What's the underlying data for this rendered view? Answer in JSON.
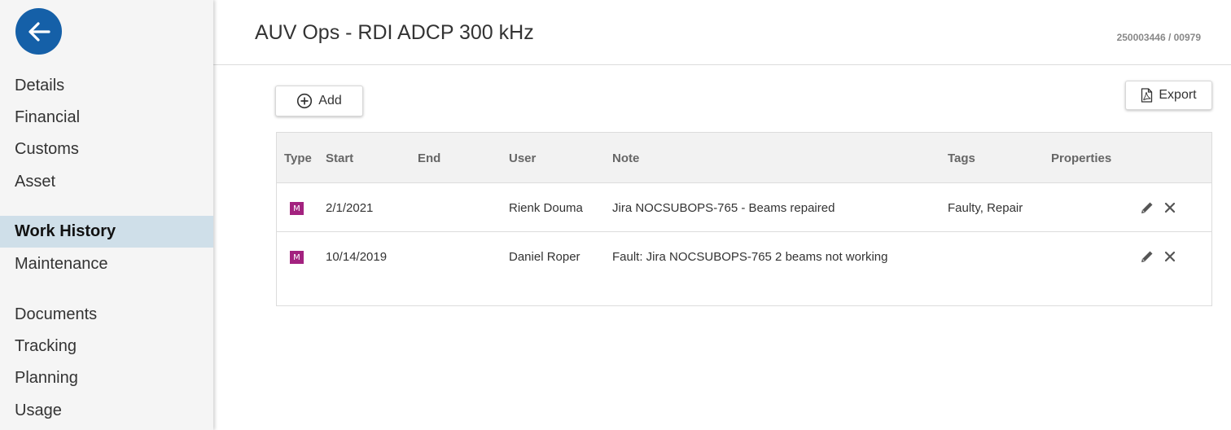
{
  "sidebar": {
    "items": [
      {
        "label": "Details"
      },
      {
        "label": "Financial"
      },
      {
        "label": "Customs"
      },
      {
        "label": "Asset"
      },
      {
        "label": "Work History",
        "active": true
      },
      {
        "label": "Maintenance"
      },
      {
        "label": "Documents"
      },
      {
        "label": "Tracking"
      },
      {
        "label": "Planning"
      },
      {
        "label": "Usage"
      }
    ]
  },
  "header": {
    "title": "AUV Ops - RDI ADCP 300 kHz",
    "record_id": "250003446 / 00979"
  },
  "toolbar": {
    "add_label": "Add",
    "export_label": "Export"
  },
  "table": {
    "columns": [
      "Type",
      "Start",
      "End",
      "User",
      "Note",
      "Tags",
      "Properties"
    ],
    "rows": [
      {
        "type": "M",
        "start": "2/1/2021",
        "end": "",
        "user": "Rienk Douma",
        "note": "Jira NOCSUBOPS-765 - Beams repaired",
        "tags": "Faulty, Repair",
        "properties": ""
      },
      {
        "type": "M",
        "start": "10/14/2019",
        "end": "",
        "user": "Daniel Roper",
        "note": "Fault: Jira NOCSUBOPS-765 2 beams not working",
        "tags": "",
        "properties": ""
      }
    ]
  },
  "colors": {
    "accent": "#1560a8",
    "active_nav": "#cfdfe9",
    "type_badge": "#a3227f"
  }
}
